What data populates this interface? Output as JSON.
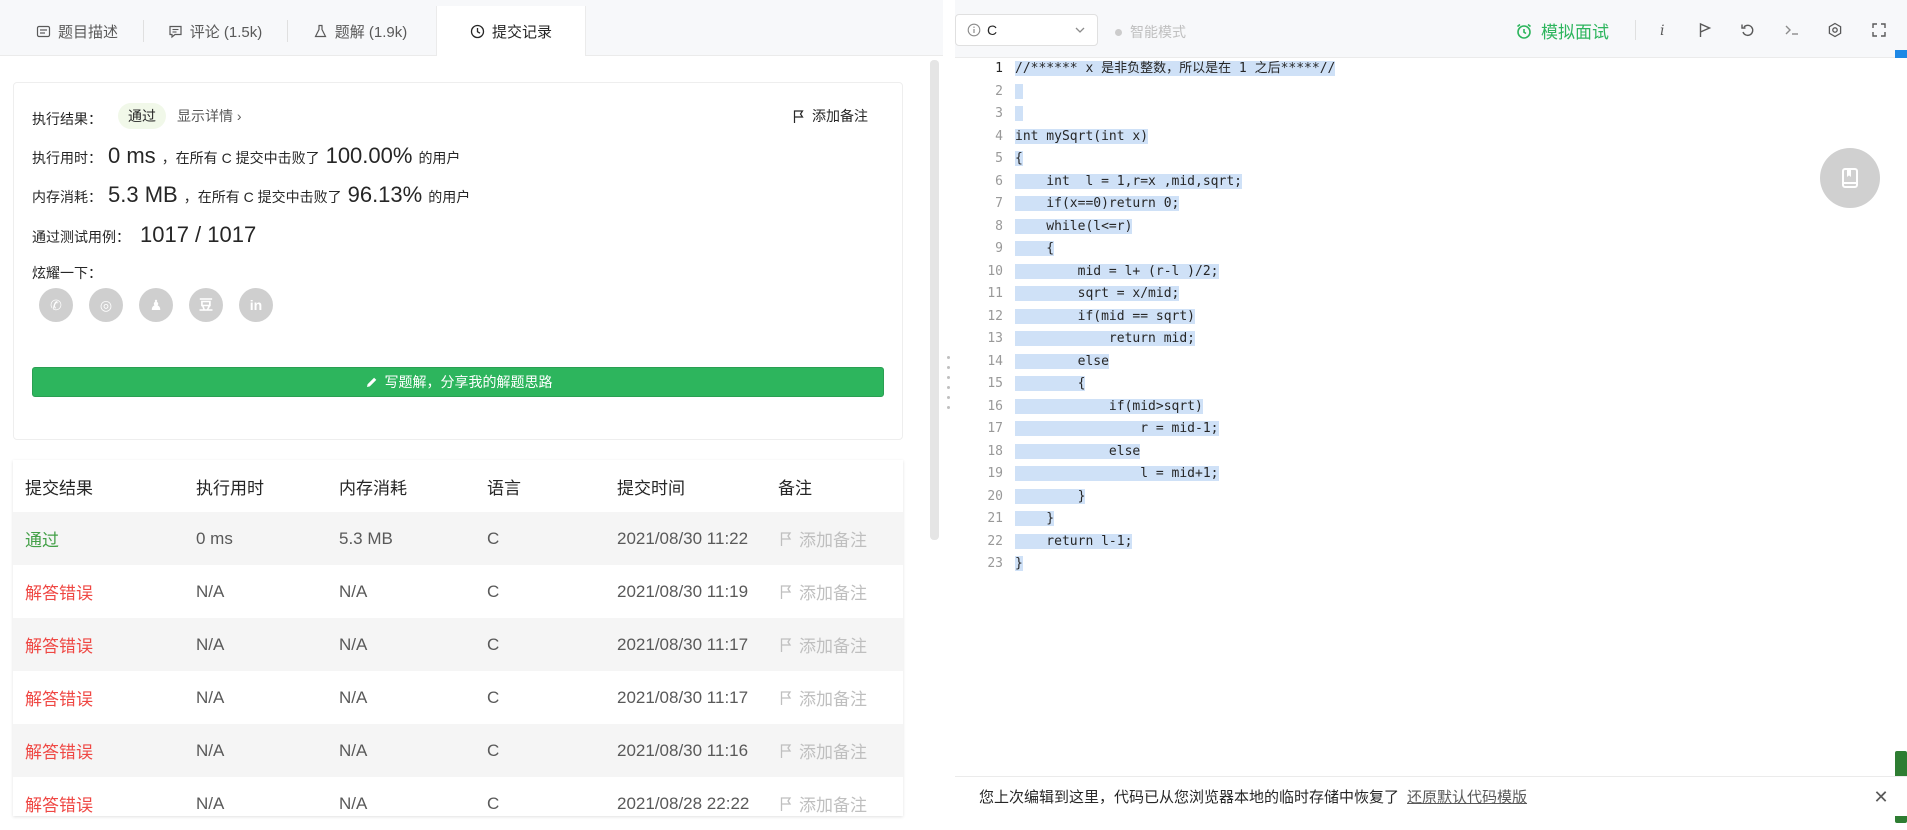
{
  "tabs": [
    {
      "label": "题目描述",
      "icon": "description-icon"
    },
    {
      "label": "评论 (1.5k)",
      "icon": "comment-icon"
    },
    {
      "label": "题解 (1.9k)",
      "icon": "flask-icon"
    },
    {
      "label": "提交记录",
      "icon": "clock-icon"
    }
  ],
  "result": {
    "status_label": "执行结果：",
    "status": "通过",
    "details": "显示详情 ›",
    "add_note": "添加备注",
    "runtime_label": "执行用时：",
    "runtime_value": "0 ms",
    "runtime_mid": "，在所有 C 提交中击败了",
    "runtime_pct": "100.00%",
    "runtime_tail": "的用户",
    "memory_label": "内存消耗：",
    "memory_value": "5.3 MB",
    "memory_mid": "，在所有 C 提交中击败了",
    "memory_pct": "96.13%",
    "memory_tail": "的用户",
    "tests_label": "通过测试用例：",
    "tests_value": "1017 / 1017",
    "share_label": "炫耀一下：",
    "share_icons": [
      "wechat-icon",
      "weibo-icon",
      "qq-icon",
      "douban-icon",
      "linkedin-icon"
    ],
    "share_glyphs": [
      "✆",
      "◎",
      "♟",
      "豆",
      "in"
    ],
    "write_button": "写题解，分享我的解题思路"
  },
  "table": {
    "headers": [
      "提交结果",
      "执行用时",
      "内存消耗",
      "语言",
      "提交时间",
      "备注"
    ],
    "rows": [
      {
        "result": "通过",
        "status": "pass",
        "time": "0 ms",
        "memory": "5.3 MB",
        "lang": "C",
        "date": "2021/08/30 11:22",
        "note": "添加备注"
      },
      {
        "result": "解答错误",
        "status": "fail",
        "time": "N/A",
        "memory": "N/A",
        "lang": "C",
        "date": "2021/08/30 11:19",
        "note": "添加备注"
      },
      {
        "result": "解答错误",
        "status": "fail",
        "time": "N/A",
        "memory": "N/A",
        "lang": "C",
        "date": "2021/08/30 11:17",
        "note": "添加备注"
      },
      {
        "result": "解答错误",
        "status": "fail",
        "time": "N/A",
        "memory": "N/A",
        "lang": "C",
        "date": "2021/08/30 11:17",
        "note": "添加备注"
      },
      {
        "result": "解答错误",
        "status": "fail",
        "time": "N/A",
        "memory": "N/A",
        "lang": "C",
        "date": "2021/08/30 11:16",
        "note": "添加备注"
      },
      {
        "result": "解答错误",
        "status": "fail",
        "time": "N/A",
        "memory": "N/A",
        "lang": "C",
        "date": "2021/08/28 22:22",
        "note": "添加备注"
      }
    ]
  },
  "toolbar": {
    "language": "C",
    "smart_mode": "智能模式",
    "mock_interview": "模拟面试",
    "icons": [
      "info-icon",
      "flag-icon",
      "reset-icon",
      "console-icon",
      "settings-icon",
      "fullscreen-icon"
    ]
  },
  "editor": {
    "lines": [
      "//****** x 是非负整数，所以是在 1 之后*****//",
      "",
      "",
      "int mySqrt(int x)",
      "{",
      "    int  l = 1,r=x ,mid,sqrt;",
      "    if(x==0)return 0;",
      "    while(l<=r)",
      "    {",
      "        mid = l+ (r-l )/2;",
      "        sqrt = x/mid;",
      "        if(mid == sqrt)",
      "            return mid;",
      "        else",
      "        {",
      "            if(mid>sqrt)",
      "                r = mid-1;",
      "            else",
      "                l = mid+1;",
      "        }",
      "    }",
      "    return l-1;",
      "}"
    ]
  },
  "notice": {
    "text": "您上次编辑到这里，代码已从您浏览器本地的临时存储中恢复了",
    "restore": "还原默认代码模版"
  },
  "colors": {
    "accent": "#2db55d",
    "pass": "#43a047",
    "fail": "#ef4743",
    "selection": "#cfe1f7"
  }
}
